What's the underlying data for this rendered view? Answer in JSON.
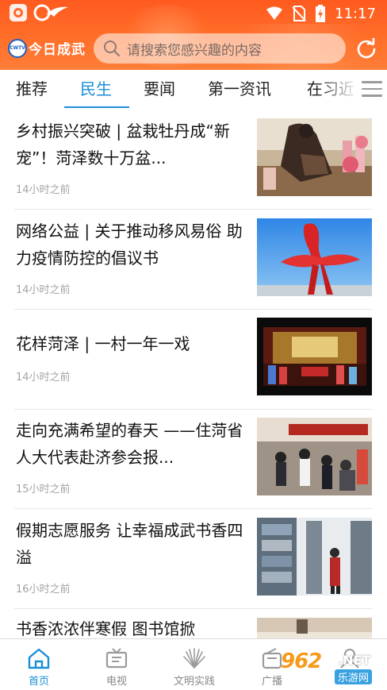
{
  "status_bar": {
    "time": "11:17",
    "icons": [
      "app-notification-icon",
      "bird-logo-icon",
      "wifi-icon",
      "no-sim-icon",
      "battery-charging-icon"
    ]
  },
  "header": {
    "logo_badge": "CWTV",
    "logo_text": "今日成武",
    "search_placeholder": "请搜索您感兴趣的内容",
    "refresh_icon": "refresh-icon",
    "accent_color": "#ff6a2a"
  },
  "tabs": {
    "items": [
      {
        "label": "推荐",
        "active": false
      },
      {
        "label": "民生",
        "active": true
      },
      {
        "label": "要闻",
        "active": false
      },
      {
        "label": "第一资讯",
        "active": false
      },
      {
        "label": "在习近",
        "active": false
      }
    ],
    "menu_icon": "menu-icon",
    "active_color": "#1a8fd8"
  },
  "news": [
    {
      "title": "乡村振兴突破 | 盆栽牡丹成“新宠”！菏泽数十万盆...",
      "time": "14小时之前"
    },
    {
      "title": "网络公益 | 关于推动移风易俗 助力疫情防控的倡议书",
      "time": "14小时之前"
    },
    {
      "title": "花样菏泽 | 一村一年一戏",
      "time": "14小时之前"
    },
    {
      "title": "走向充满希望的春天 ——住菏省人大代表赴济参会报...",
      "time": "15小时之前"
    },
    {
      "title": "假期志愿服务 让幸福成武书香四溢",
      "time": "16小时之前"
    },
    {
      "title": "书香浓浓伴寒假 图书馆掀",
      "time": ""
    }
  ],
  "bottom_nav": {
    "items": [
      {
        "label": "首页",
        "icon": "home-icon",
        "active": true
      },
      {
        "label": "电视",
        "icon": "tv-icon",
        "active": false
      },
      {
        "label": "文明实践",
        "icon": "civilization-icon",
        "active": false
      },
      {
        "label": "广播",
        "icon": "radio-icon",
        "active": false
      },
      {
        "label": "",
        "icon": "profile-icon",
        "active": false
      }
    ]
  },
  "watermark": {
    "brand": "962",
    "suffix": ".NET",
    "cn": "乐游网"
  }
}
